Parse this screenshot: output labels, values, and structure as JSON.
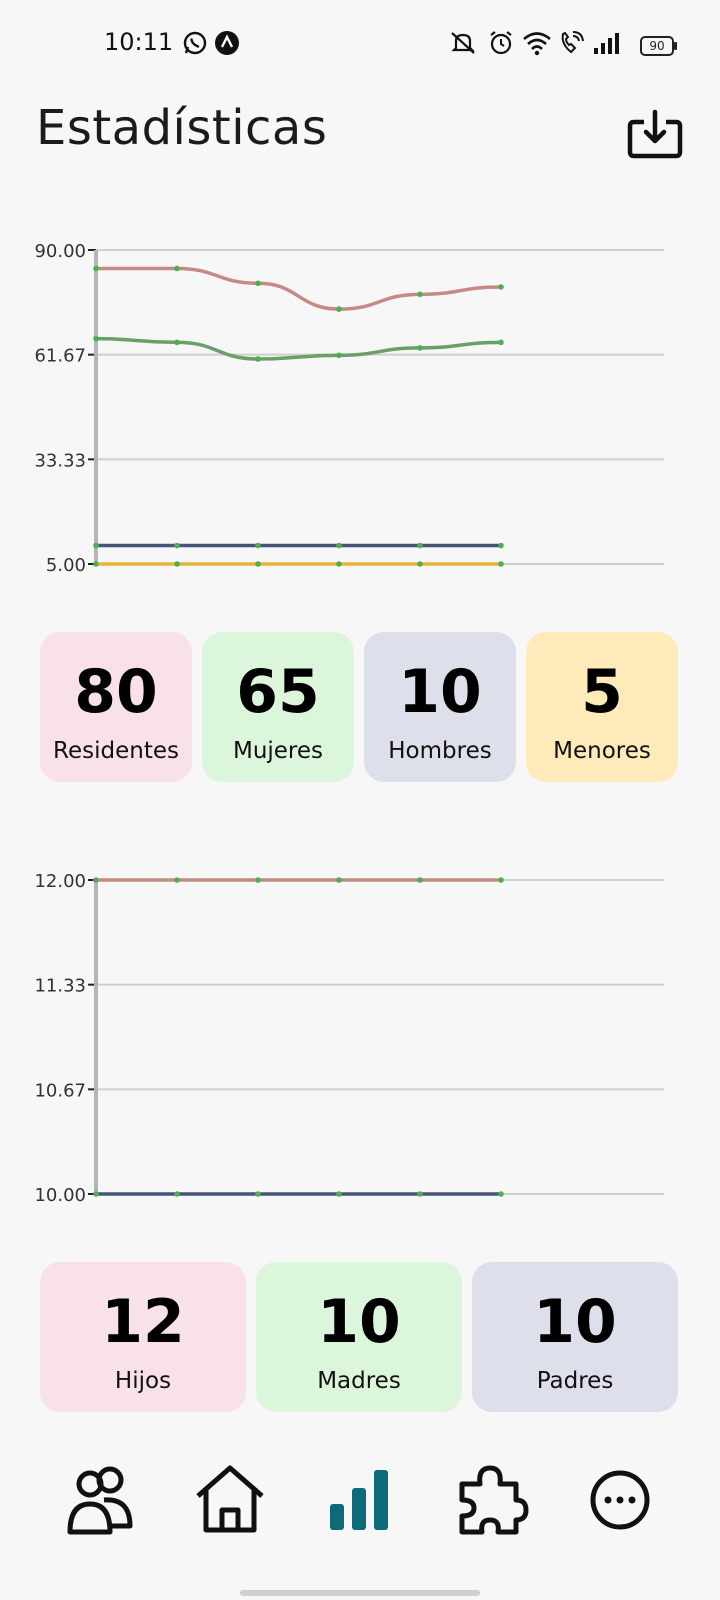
{
  "status_bar": {
    "time": "10:11",
    "battery": "90",
    "icons": [
      "whatsapp-icon",
      "arc-app-icon",
      "mute-icon",
      "alarm-icon",
      "wifi-icon",
      "wifi-call-icon",
      "signal-icon",
      "battery-icon"
    ]
  },
  "header": {
    "title": "Estadísticas",
    "download_icon": "download-icon"
  },
  "colors": {
    "residentes": "#c58a85",
    "mujeres": "#6a9f6a",
    "hombres": "#46537a",
    "menores": "#e6b53a",
    "point": "#4caf50",
    "nav_active": "#0d6a7a",
    "card_pink": "#f9e1e9",
    "card_green": "#dcf6dc",
    "card_lavender": "#dddfea",
    "card_yellow": "#feebb9"
  },
  "summary1": [
    {
      "value": "80",
      "label": "Residentes"
    },
    {
      "value": "65",
      "label": "Mujeres"
    },
    {
      "value": "10",
      "label": "Hombres"
    },
    {
      "value": "5",
      "label": "Menores"
    }
  ],
  "summary2": [
    {
      "value": "12",
      "label": "Hijos"
    },
    {
      "value": "10",
      "label": "Madres"
    },
    {
      "value": "10",
      "label": "Padres"
    }
  ],
  "chart_data": [
    {
      "type": "line",
      "ylim": [
        5,
        90
      ],
      "yticks": [
        "90.00",
        "61.67",
        "33.33",
        "5.00"
      ],
      "x": [
        0,
        1,
        2,
        3,
        4,
        5
      ],
      "grid": true,
      "series": [
        {
          "key": "residentes",
          "values": [
            85,
            85,
            81,
            74,
            78,
            80
          ]
        },
        {
          "key": "mujeres",
          "values": [
            66,
            65,
            60.5,
            61.5,
            63.5,
            65
          ]
        },
        {
          "key": "hombres",
          "values": [
            10,
            10,
            10,
            10,
            10,
            10
          ]
        },
        {
          "key": "menores",
          "values": [
            5,
            5,
            5,
            5,
            5,
            5
          ]
        }
      ]
    },
    {
      "type": "line",
      "ylim": [
        10,
        12
      ],
      "yticks": [
        "12.00",
        "11.33",
        "10.67",
        "10.00"
      ],
      "x": [
        0,
        1,
        2,
        3,
        4,
        5
      ],
      "grid": true,
      "series": [
        {
          "key": "residentes",
          "values": [
            12,
            12,
            12,
            12,
            12,
            12
          ]
        },
        {
          "key": "hombres",
          "values": [
            10,
            10,
            10,
            10,
            10,
            10
          ]
        }
      ]
    }
  ],
  "nav": {
    "active": "stats",
    "items": [
      "users-icon",
      "home-icon",
      "stats-icon",
      "puzzle-icon",
      "more-icon"
    ]
  }
}
